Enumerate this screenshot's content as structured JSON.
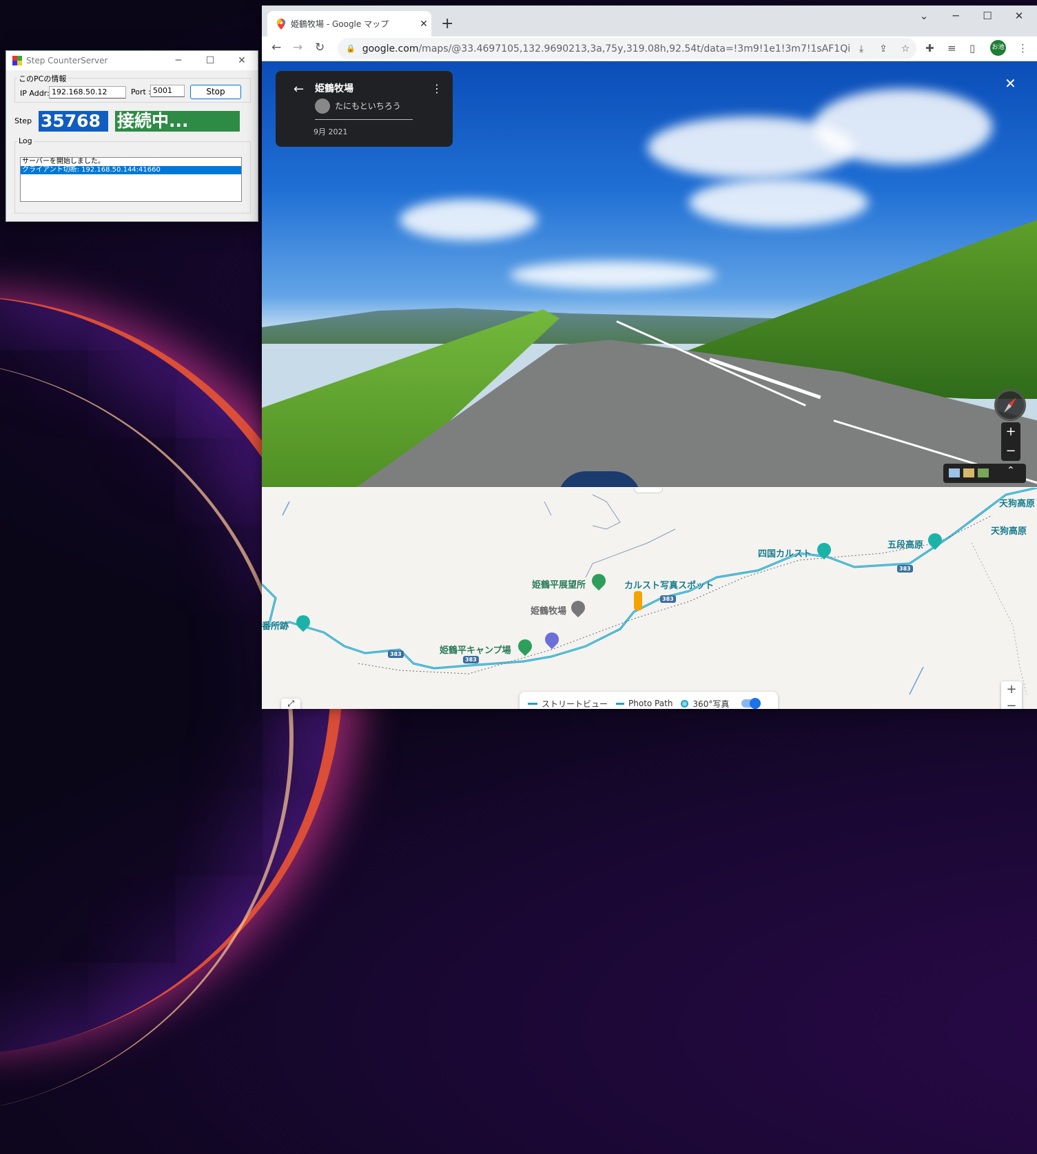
{
  "step_server": {
    "title": "Step CounterServer",
    "group_label": "このPCの情報",
    "ip_label": "IP Addr:",
    "ip_value": "192.168.50.12",
    "port_label": "Port :",
    "port_value": "5001",
    "stop_button": "Stop",
    "step_label": "Step",
    "step_value": "35768",
    "status_value": "接続中...",
    "log_label": "Log",
    "log_lines": [
      "サーバーを開始しました。",
      "クライアント切断: 192.168.50.144:41660"
    ]
  },
  "browser": {
    "tab_title": "姫鶴牧場 - Google マップ",
    "url_host": "google.com",
    "url_path": "/maps/@33.4697105,132.9690213,3a,75y,319.08h,92.54t/data=!3m9!1e1!3m7!1sAF1QipNwjdF1Vw_7...",
    "profile_label": "お池"
  },
  "streetview": {
    "place_name": "姫鶴牧場",
    "contributor": "たにもといちろう",
    "date": "9月 2021"
  },
  "map": {
    "places": {
      "tengu_kogen_1": "天狗高原",
      "tengu_kogen_2": "天狗高原",
      "gotan_kogen": "五段高原",
      "shikoku_karst": "四国カルスト",
      "karst_photo_spot": "カルスト写真スポット",
      "himetsuru_observatory": "姫鶴平展望所",
      "himetsuru_ranch": "姫鶴牧場",
      "himetsuru_camp": "姫鶴平キャンプ場",
      "guard_house": "番所跡"
    },
    "route_shields": [
      "383",
      "383",
      "383",
      "383"
    ],
    "legend": {
      "street_view": "ストリートビュー",
      "photo_path": "Photo Path",
      "photo_360": "360°写真"
    }
  },
  "colors": {
    "accent_blue": "#0f5ec0",
    "status_green": "#2e8b46",
    "route_teal": "#1aa3c7"
  }
}
